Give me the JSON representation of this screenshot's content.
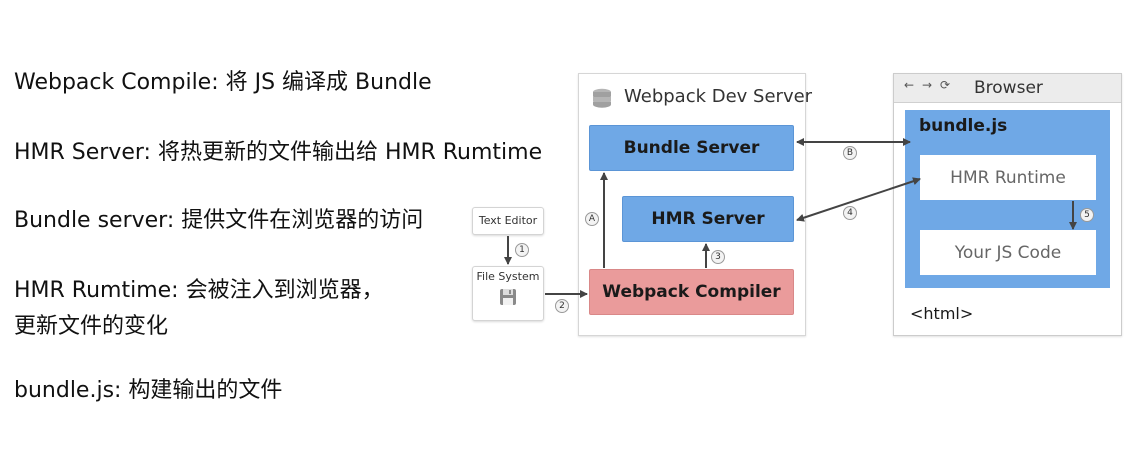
{
  "notes": [
    "Webpack Compile: 将 JS 编译成 Bundle",
    "HMR Server: 将热更新的文件输出给 HMR Rumtime",
    "Bundle server: 提供文件在浏览器的访问",
    "HMR Rumtime: 会被注入到浏览器，",
    "更新文件的变化",
    "bundle.js: 构建输出的文件"
  ],
  "diagram": {
    "text_editor": "Text Editor",
    "file_system": "File System",
    "dev_server_title": "Webpack Dev Server",
    "bundle_server": "Bundle Server",
    "hmr_server": "HMR Server",
    "webpack_compiler": "Webpack Compiler",
    "browser_title": "Browser",
    "bundle_js": "bundle.js",
    "hmr_runtime": "HMR Runtime",
    "your_js_code": "Your JS Code",
    "html_tag": "<html>",
    "steps": {
      "one": "1",
      "two": "2",
      "three": "3",
      "four": "4",
      "five": "5",
      "a": "A",
      "b": "B"
    }
  },
  "colors": {
    "blue": "#6fa8e6",
    "red": "#ea9b9b",
    "arrow": "#444444"
  },
  "icons": [
    "database-icon",
    "floppy-disk-icon",
    "back-arrow-icon",
    "forward-arrow-icon",
    "reload-icon"
  ]
}
